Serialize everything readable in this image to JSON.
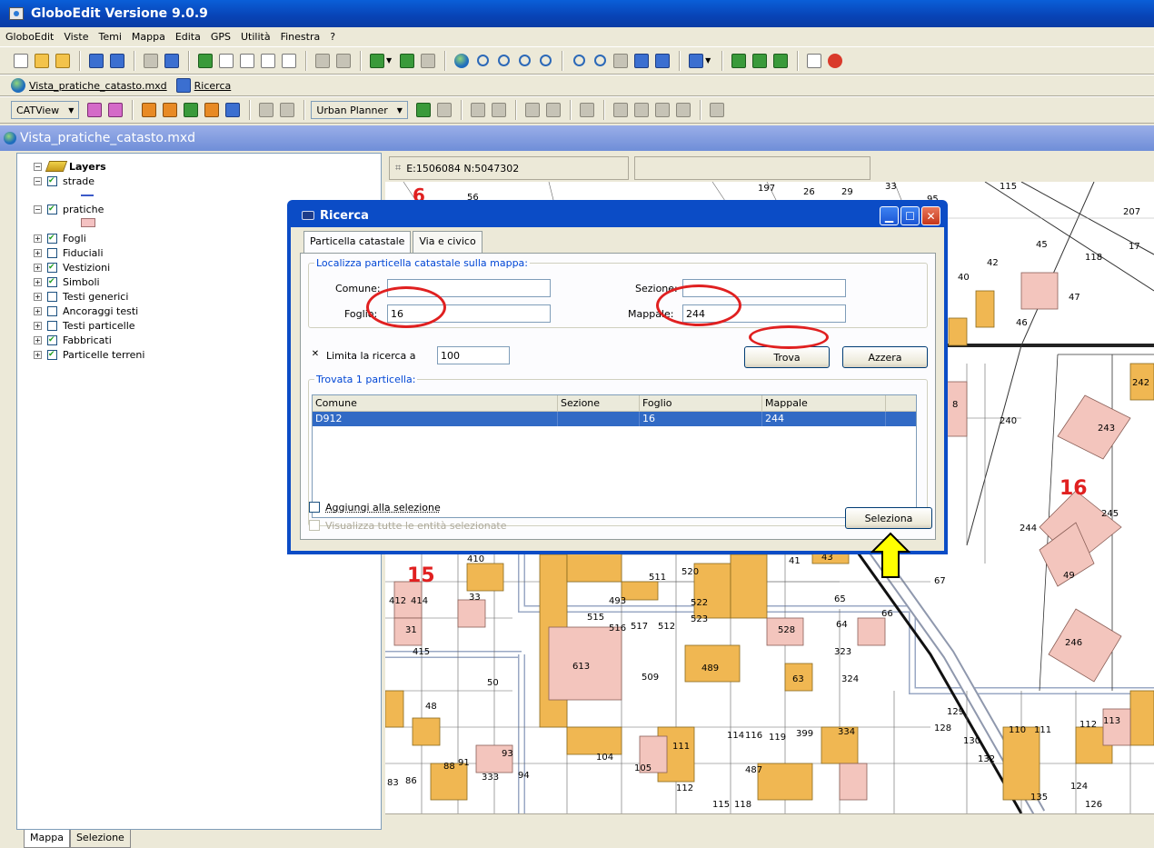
{
  "app": {
    "title": "GloboEdit Versione 9.0.9"
  },
  "menu": [
    "GloboEdit",
    "Viste",
    "Temi",
    "Mappa",
    "Edita",
    "GPS",
    "Utilità",
    "Finestra",
    "?"
  ],
  "toolbar2": {
    "map_link": "Vista_pratiche_catasto.mxd",
    "search_link": "Ricerca"
  },
  "toolbar3": {
    "catview": "CATView",
    "urban": "Urban Planner"
  },
  "document": {
    "title": "Vista_pratiche_catasto.mxd"
  },
  "toc": {
    "root": "Layers",
    "layers": [
      {
        "name": "strade",
        "checked": true
      },
      {
        "name": "pratiche",
        "checked": true
      },
      {
        "name": "Fogli",
        "checked": true
      },
      {
        "name": "Fiduciali",
        "checked": false
      },
      {
        "name": "Vestizioni",
        "checked": true
      },
      {
        "name": "Simboli",
        "checked": true
      },
      {
        "name": "Testi generici",
        "checked": false
      },
      {
        "name": "Ancoraggi testi",
        "checked": false
      },
      {
        "name": "Testi particelle",
        "checked": false
      },
      {
        "name": "Fabbricati",
        "checked": true
      },
      {
        "name": "Particelle terreni",
        "checked": true
      }
    ],
    "tabs": [
      "Mappa",
      "Selezione"
    ]
  },
  "map": {
    "coords": "E:1506084 N:5047302",
    "labels": {
      "sheet6": "6",
      "sheet15": "15",
      "sheet16": "16",
      "p56": "56",
      "p197": "197",
      "p26": "26",
      "p29": "29",
      "p33": "33",
      "p95": "95",
      "p115": "115",
      "p207": "207",
      "p17": "17",
      "p45": "45",
      "p118": "118",
      "p42": "42",
      "p47": "47",
      "p40": "40",
      "p46": "46",
      "p8": "8",
      "p240": "240",
      "p242": "242",
      "p243": "243",
      "p244": "244",
      "p245": "245",
      "p49": "49",
      "p246": "246",
      "p67": "67",
      "p66": "66",
      "p410": "410",
      "p412": "412",
      "p414": "414",
      "p33b": "33",
      "p31": "31",
      "p415": "415",
      "p50": "50",
      "p48": "48",
      "p613": "613",
      "p489": "489",
      "p509": "509",
      "p63": "63",
      "p324": "324",
      "p528": "528",
      "p323": "323",
      "p334": "334",
      "p119": "119",
      "p399": "399",
      "p114": "114",
      "p116": "116",
      "p111": "111",
      "p105": "105",
      "p104": "104",
      "p487": "487",
      "p493": "493",
      "p515": "515",
      "p516": "516",
      "p517": "517",
      "p512": "512",
      "p520": "520",
      "p522": "522",
      "p523": "523",
      "p511": "511",
      "p88": "88",
      "p91": "91",
      "p83": "83",
      "p86": "86",
      "p333": "333",
      "p94": "94",
      "p93": "93",
      "p112": "112",
      "p115b": "115",
      "p118b": "118",
      "p129": "129",
      "p130": "130",
      "p110": "110",
      "p111b": "111",
      "p112b": "112",
      "p113": "113",
      "p132": "132",
      "p135": "135",
      "p126": "126",
      "p128": "128",
      "p124": "124",
      "p41": "41",
      "p43": "43",
      "p65": "65",
      "p64": "64"
    }
  },
  "dialog": {
    "title": "Ricerca",
    "tabs": [
      "Particella catastale",
      "Via e civico"
    ],
    "group1_legend": "Localizza particella catastale sulla mappa:",
    "comune_label": "Comune:",
    "comune_value": "",
    "sezione_label": "Sezione:",
    "sezione_value": "",
    "foglio_label": "Foglio:",
    "foglio_value": "16",
    "mappale_label": "Mappale:",
    "mappale_value": "244",
    "limit_label": "Limita la ricerca a",
    "limit_value": "100",
    "limit_checked": "✕",
    "trova": "Trova",
    "azzera": "Azzera",
    "group2_legend": "Trovata 1 particella:",
    "columns": [
      "Comune",
      "Sezione",
      "Foglio",
      "Mappale"
    ],
    "rows": [
      [
        "D912",
        "",
        "16",
        "244"
      ]
    ],
    "add_selection": "Aggiungi alla selezione",
    "show_all": "Visualizza tutte le entità selezionate",
    "seleziona": "Seleziona"
  }
}
